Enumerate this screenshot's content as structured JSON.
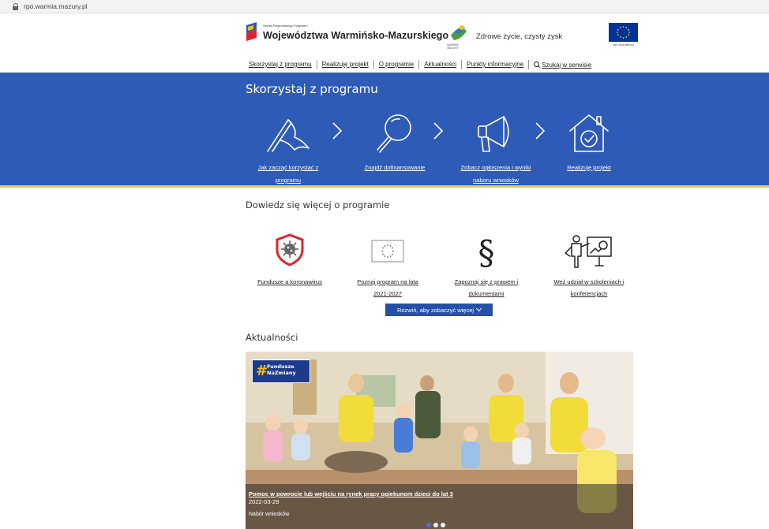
{
  "browser": {
    "url": "rpo.warmia.mazury.pl"
  },
  "header": {
    "logo_small_text": "Serwis Regionalnego Programu",
    "logo_title": "Województwa Warmińsko-Mazurskiego",
    "wm_logo_text": "WARMIA MAZURY",
    "slogan": "Zdrowe życie, czysty zysk",
    "eu_text": "UNIA EUROPEJSKA",
    "nav": [
      {
        "label": "Skorzystaj z programu"
      },
      {
        "label": "Realizuję projekt"
      },
      {
        "label": "O programie"
      },
      {
        "label": "Aktualności"
      },
      {
        "label": "Punkty informacyjne"
      }
    ],
    "search_label": "Szukaj w serwisie"
  },
  "band": {
    "title": "Skorzystaj z programu",
    "steps": [
      {
        "label_line1": "Jak zacząć korzystać z",
        "label_line2": "programu",
        "icon": "flag-icon"
      },
      {
        "label_line1": "Znajdź dofinansowanie",
        "label_line2": "",
        "icon": "magnifier-icon"
      },
      {
        "label_line1": "Zobacz ogłoszenia i wyniki",
        "label_line2": "naboru wniosków",
        "icon": "megaphone-icon"
      },
      {
        "label_line1": "Realizuję projekt",
        "label_line2": "",
        "icon": "house-check-icon"
      }
    ]
  },
  "learn_more": {
    "title": "Dowiedz się więcej o programie",
    "items": [
      {
        "label_line1": "Fundusze a koronawirus",
        "label_line2": "",
        "icon": "virus-shield-icon"
      },
      {
        "label_line1": "Poznaj program na lata",
        "label_line2": "2021-2027",
        "icon": "eu-flag-icon"
      },
      {
        "label_line1": "Zapoznaj się z prawem i",
        "label_line2": "dokumentami",
        "icon": "paragraph-icon"
      },
      {
        "label_line1": "Weź udział w szkoleniach i",
        "label_line2": "konferencjach",
        "icon": "presentation-icon"
      }
    ],
    "expand_label": "Rozwiń, aby zobaczyć więcej"
  },
  "news": {
    "title": "Aktualności",
    "badge_line1": "Fundusze",
    "badge_line2": "NaZmiany",
    "headline": "Pomoc w powrocie lub wejściu na rynek pracy opiekunom dzieci do lat 3",
    "date": "2022-03-29",
    "category": "Nabór wniosków",
    "active_slide": 1,
    "slides": 3
  },
  "colors": {
    "band_blue": "#2e5bb8",
    "button_blue": "#2650a8",
    "accent_yellow": "#e8c84a"
  }
}
